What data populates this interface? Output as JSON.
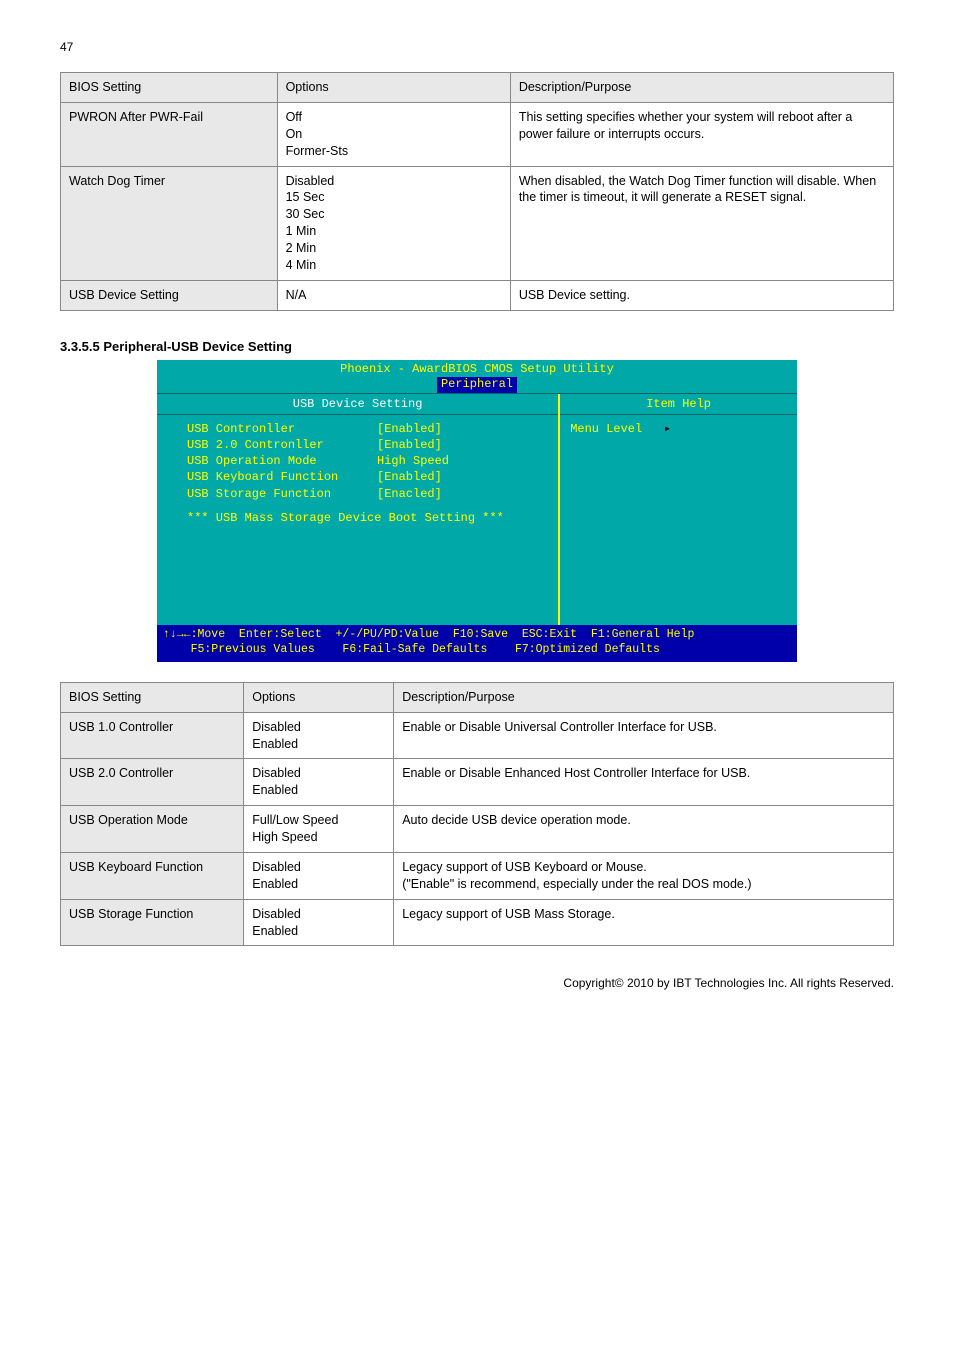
{
  "topLeftPage": "47",
  "table1": {
    "headers": [
      "BIOS Setting",
      "Options",
      "Description/Purpose"
    ],
    "rows": [
      [
        "PWRON After PWR-Fail",
        "Off\nOn\nFormer-Sts",
        "This setting specifies whether your system will reboot after a power failure or interrupts occurs."
      ],
      [
        "Watch Dog Timer",
        "Disabled\n15 Sec\n30 Sec\n1 Min\n2 Min\n4 Min",
        "When disabled, the Watch Dog Timer function will disable. When the timer is timeout, it will generate a RESET signal."
      ],
      [
        "USB Device Setting",
        "N/A",
        "USB Device setting."
      ]
    ]
  },
  "section": {
    "number": "3.3.5.5",
    "title": "Peripheral-USB Device Setting"
  },
  "bios": {
    "title1": "Phoenix - AwardBIOS CMOS Setup Utility",
    "title2": "Peripheral",
    "leftHeader": "USB Device Setting",
    "rightHeader": "Item Help",
    "menuLevel": "Menu Level",
    "items": [
      {
        "label": "USB Contronller",
        "value": "[Enabled]"
      },
      {
        "label": "USB 2.0 Contronller",
        "value": "[Enabled]"
      },
      {
        "label": "USB Operation Mode",
        "value": "High Speed"
      },
      {
        "label": "USB Keyboard Function",
        "value": "[Enabled]"
      },
      {
        "label": "USB Storage Function",
        "value": "[Enacled]"
      }
    ],
    "note": "*** USB Mass Storage Device Boot Setting ***",
    "foot1": "↑↓→←:Move  Enter:Select  +/-/PU/PD:Value  F10:Save  ESC:Exit  F1:General Help",
    "foot2": "    F5:Previous Values    F6:Fail-Safe Defaults    F7:Optimized Defaults"
  },
  "table2": {
    "headers": [
      "BIOS Setting",
      "Options",
      "Description/Purpose"
    ],
    "rows": [
      [
        "USB 1.0 Controller",
        "Disabled\nEnabled",
        "Enable or Disable Universal Controller Interface for USB."
      ],
      [
        "USB 2.0 Controller",
        "Disabled\nEnabled",
        "Enable or Disable Enhanced Host Controller Interface for USB."
      ],
      [
        "USB Operation Mode",
        "Full/Low Speed\nHigh Speed",
        "Auto decide USB device operation mode."
      ],
      [
        "USB Keyboard Function",
        "Disabled\nEnabled",
        "Legacy support of USB Keyboard or Mouse.\n(\"Enable\" is recommend, especially under the real DOS mode.)"
      ],
      [
        "USB Storage Function",
        "Disabled\nEnabled",
        "Legacy support of USB Mass Storage."
      ]
    ]
  },
  "footerPage": "Copyright© 2010 by IBT Technologies Inc. All rights Reserved."
}
